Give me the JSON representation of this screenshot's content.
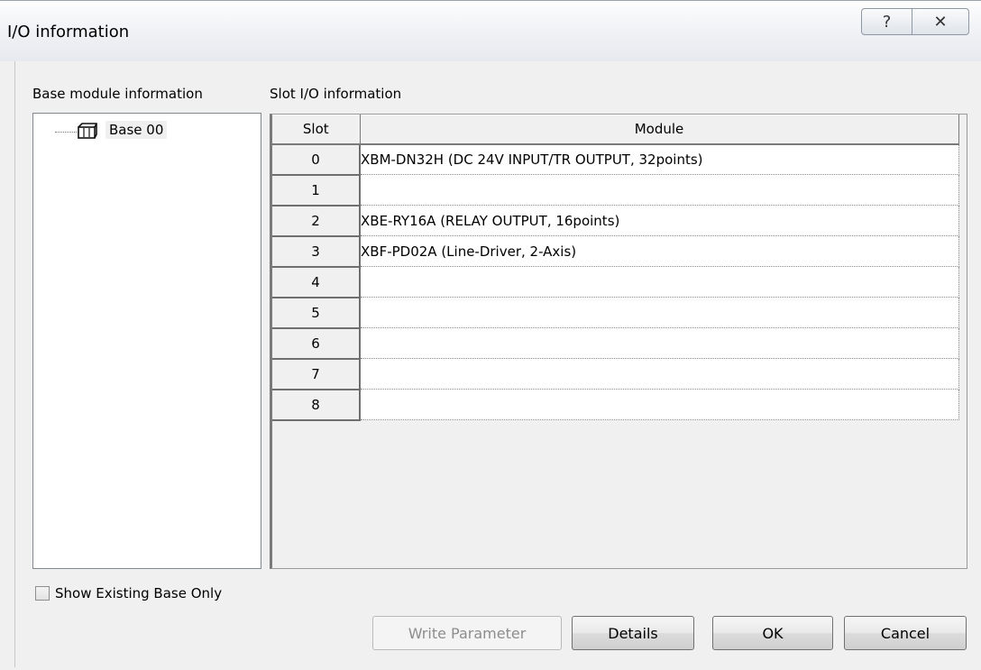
{
  "window": {
    "title": "I/O information",
    "help_icon": "question-help-icon",
    "close_icon": "close-x-icon",
    "help_glyph": "?",
    "close_glyph": "✕"
  },
  "base_panel": {
    "label": "Base module information",
    "tree": [
      {
        "label": "Base 00",
        "icon": "base-rack-icon",
        "selected": true
      }
    ]
  },
  "slot_panel": {
    "label": "Slot I/O information",
    "columns": [
      "Slot",
      "Module"
    ],
    "rows": [
      {
        "slot": "0",
        "module": "XBM-DN32H (DC 24V INPUT/TR OUTPUT, 32points)"
      },
      {
        "slot": "1",
        "module": ""
      },
      {
        "slot": "2",
        "module": "XBE-RY16A (RELAY OUTPUT, 16points)"
      },
      {
        "slot": "3",
        "module": "XBF-PD02A (Line-Driver, 2-Axis)"
      },
      {
        "slot": "4",
        "module": ""
      },
      {
        "slot": "5",
        "module": ""
      },
      {
        "slot": "6",
        "module": ""
      },
      {
        "slot": "7",
        "module": ""
      },
      {
        "slot": "8",
        "module": ""
      }
    ]
  },
  "options": {
    "show_existing_label": "Show Existing Base Only",
    "show_existing_checked": false
  },
  "buttons": {
    "write_parameter": "Write Parameter",
    "write_parameter_enabled": false,
    "details": "Details",
    "ok": "OK",
    "cancel": "Cancel"
  }
}
